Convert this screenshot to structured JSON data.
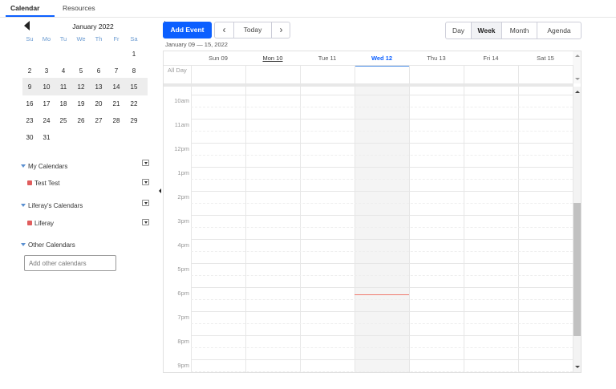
{
  "top_tabs": [
    "Calendar",
    "Resources"
  ],
  "mini_calendar": {
    "title": "January 2022",
    "dow": [
      "Su",
      "Mo",
      "Tu",
      "We",
      "Th",
      "Fr",
      "Sa"
    ],
    "days": [
      [
        "",
        "",
        "",
        "",
        "",
        "",
        "1"
      ],
      [
        "2",
        "3",
        "4",
        "5",
        "6",
        "7",
        "8"
      ],
      [
        "9",
        "10",
        "11",
        "12",
        "13",
        "14",
        "15"
      ],
      [
        "16",
        "17",
        "18",
        "19",
        "20",
        "21",
        "22"
      ],
      [
        "23",
        "24",
        "25",
        "26",
        "27",
        "28",
        "29"
      ],
      [
        "30",
        "31",
        "",
        "",
        "",
        "",
        ""
      ]
    ]
  },
  "calendars": {
    "my_label": "My Calendars",
    "my_item": "Test Test",
    "liferay_label": "Liferay's Calendars",
    "liferay_item": "Liferay",
    "other_label": "Other Calendars",
    "add_placeholder": "Add other calendars",
    "swatch_color": "#e05d5d"
  },
  "toolbar": {
    "add_event": "Add Event",
    "prev": "‹",
    "today": "Today",
    "next": "›",
    "range": "January 09 — 15, 2022",
    "views": [
      "Day",
      "Week",
      "Month",
      "Agenda"
    ],
    "active_view": "Week"
  },
  "week": {
    "days": [
      "Sun 09",
      "Mon 10",
      "Tue 11",
      "Wed 12",
      "Thu 13",
      "Fri 14",
      "Sat 15"
    ],
    "today_index": 3,
    "allday_label": "All Day",
    "times": [
      "10am",
      "11am",
      "12pm",
      "1pm",
      "2pm",
      "3pm",
      "4pm",
      "5pm",
      "6pm",
      "7pm",
      "8pm",
      "9pm"
    ]
  },
  "colors": {
    "accent": "#0b5fff",
    "now_line": "#f07a6e"
  }
}
